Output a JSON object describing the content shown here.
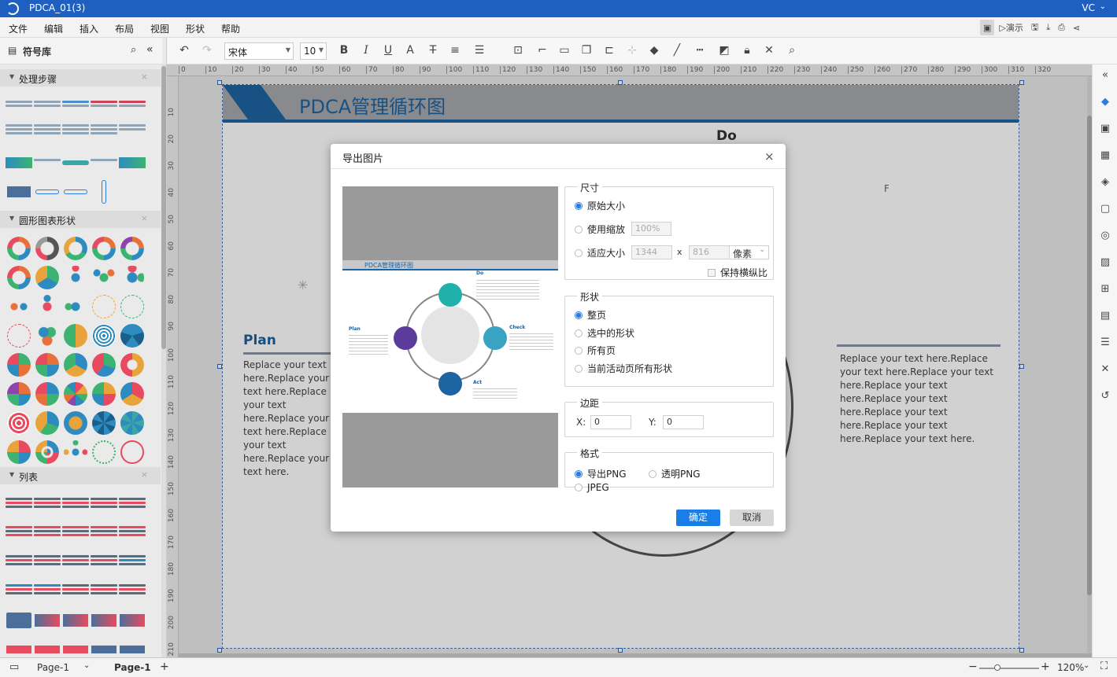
{
  "app": {
    "title": "PDCA_01(3)",
    "user": "VC"
  },
  "menu": [
    "文件",
    "编辑",
    "插入",
    "布局",
    "视图",
    "形状",
    "帮助"
  ],
  "menu_right": {
    "present": "演示"
  },
  "toolbar": {
    "font": "宋体",
    "size": "10"
  },
  "left_panel": {
    "title": "符号库",
    "sections": [
      {
        "label": "处理步骤"
      },
      {
        "label": "圆形图表形状"
      },
      {
        "label": "列表"
      }
    ]
  },
  "ruler_h": [
    "0",
    "10",
    "20",
    "30",
    "40",
    "50",
    "60",
    "70",
    "80",
    "90",
    "100",
    "110",
    "120",
    "130",
    "140",
    "150",
    "160",
    "170",
    "180",
    "190",
    "200",
    "210",
    "220",
    "230",
    "240",
    "250",
    "260",
    "270",
    "280",
    "290",
    "300",
    "310",
    "320"
  ],
  "ruler_v": [
    "10",
    "20",
    "30",
    "40",
    "50",
    "60",
    "70",
    "80",
    "90",
    "100",
    "110",
    "120",
    "130",
    "140",
    "150",
    "160",
    "170",
    "180",
    "190",
    "200",
    "210"
  ],
  "canvas": {
    "title": "PDCA管理循环图",
    "do": "Do",
    "plan": "Plan",
    "plan_text": "Replace your text here.Replace your text here.Replace your text here.Replace your text here.Replace your text here.Replace your text here.",
    "right_text": "Replace your text here.Replace your text here.Replace your text here.Replace your text here.Replace your text here.Replace your text here.Replace your text here.Replace your text here."
  },
  "preview": {
    "title": "PDCA管理循环图",
    "do": "Do",
    "plan": "Plan",
    "check": "Check",
    "act": "Act"
  },
  "dialog": {
    "title": "导出图片",
    "size": {
      "legend": "尺寸",
      "original": "原始大小",
      "zoom": "使用缩放",
      "zoom_value": "100%",
      "fit": "适应大小",
      "width": "1344",
      "x": "x",
      "height": "816",
      "unit": "像素",
      "keep_ratio": "保持横纵比"
    },
    "shape": {
      "legend": "形状",
      "options": [
        "整页",
        "选中的形状",
        "所有页",
        "当前活动页所有形状"
      ]
    },
    "margin": {
      "legend": "边距",
      "x_label": "X:",
      "x_value": "0",
      "y_label": "Y:",
      "y_value": "0"
    },
    "format": {
      "legend": "格式",
      "png": "导出PNG",
      "tpng": "透明PNG",
      "jpeg": "JPEG"
    },
    "ok": "确定",
    "cancel": "取消"
  },
  "status": {
    "page_select": "Page-1",
    "page_tab": "Page-1",
    "zoom": "120%"
  }
}
